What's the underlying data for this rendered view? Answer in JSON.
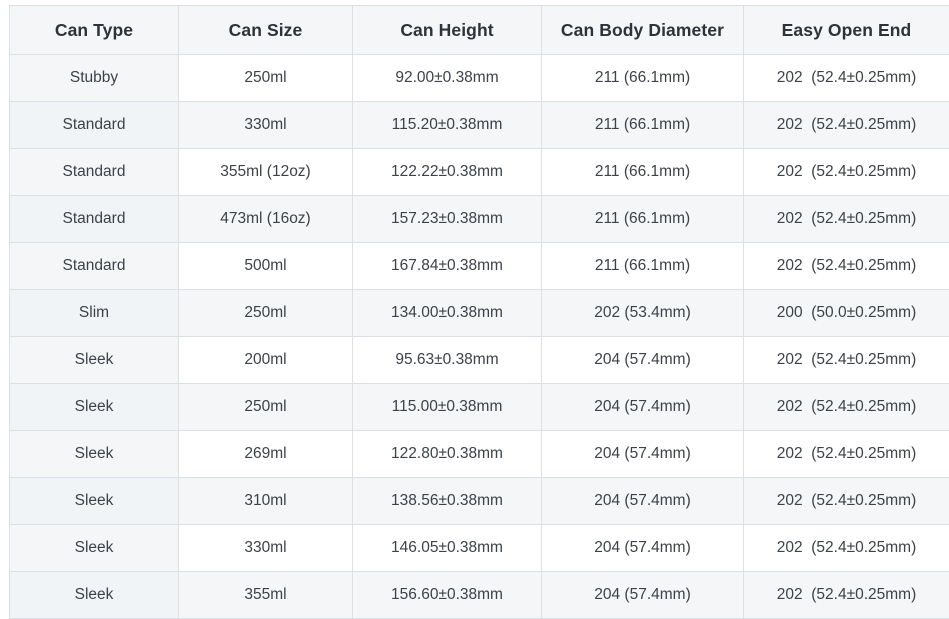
{
  "table": {
    "columns": [
      "Can Type",
      "Can Size",
      "Can Height",
      "Can Body Diameter",
      "Easy Open End"
    ],
    "rows": [
      {
        "can_type": "Stubby",
        "can_size": "250ml",
        "can_height": "92.00±0.38mm",
        "can_body_diameter": "211 (66.1mm)",
        "easy_open_end": "202  (52.4±0.25mm)"
      },
      {
        "can_type": "Standard",
        "can_size": "330ml",
        "can_height": "115.20±0.38mm",
        "can_body_diameter": "211 (66.1mm)",
        "easy_open_end": "202  (52.4±0.25mm)"
      },
      {
        "can_type": "Standard",
        "can_size": "355ml (12oz)",
        "can_height": "122.22±0.38mm",
        "can_body_diameter": "211 (66.1mm)",
        "easy_open_end": "202  (52.4±0.25mm)"
      },
      {
        "can_type": "Standard",
        "can_size": "473ml (16oz)",
        "can_height": "157.23±0.38mm",
        "can_body_diameter": "211 (66.1mm)",
        "easy_open_end": "202  (52.4±0.25mm)"
      },
      {
        "can_type": "Standard",
        "can_size": "500ml",
        "can_height": "167.84±0.38mm",
        "can_body_diameter": "211 (66.1mm)",
        "easy_open_end": "202  (52.4±0.25mm)"
      },
      {
        "can_type": "Slim",
        "can_size": "250ml",
        "can_height": "134.00±0.38mm",
        "can_body_diameter": "202 (53.4mm)",
        "easy_open_end": "200  (50.0±0.25mm)"
      },
      {
        "can_type": "Sleek",
        "can_size": "200ml",
        "can_height": "95.63±0.38mm",
        "can_body_diameter": "204 (57.4mm)",
        "easy_open_end": "202  (52.4±0.25mm)"
      },
      {
        "can_type": "Sleek",
        "can_size": "250ml",
        "can_height": "115.00±0.38mm",
        "can_body_diameter": "204 (57.4mm)",
        "easy_open_end": "202  (52.4±0.25mm)"
      },
      {
        "can_type": "Sleek",
        "can_size": "269ml",
        "can_height": "122.80±0.38mm",
        "can_body_diameter": "204 (57.4mm)",
        "easy_open_end": "202  (52.4±0.25mm)"
      },
      {
        "can_type": "Sleek",
        "can_size": "310ml",
        "can_height": "138.56±0.38mm",
        "can_body_diameter": "204 (57.4mm)",
        "easy_open_end": "202  (52.4±0.25mm)"
      },
      {
        "can_type": "Sleek",
        "can_size": "330ml",
        "can_height": "146.05±0.38mm",
        "can_body_diameter": "204 (57.4mm)",
        "easy_open_end": "202  (52.4±0.25mm)"
      },
      {
        "can_type": "Sleek",
        "can_size": "355ml",
        "can_height": "156.60±0.38mm",
        "can_body_diameter": "204 (57.4mm)",
        "easy_open_end": "202  (52.4±0.25mm)"
      }
    ]
  },
  "colors": {
    "border": "#dcdfe3",
    "header_bg": "#f4f6f8",
    "stripe_bg": "#f4f6f8",
    "row_bg": "#ffffff",
    "text": "#3c4248",
    "header_text": "#2e3339"
  }
}
